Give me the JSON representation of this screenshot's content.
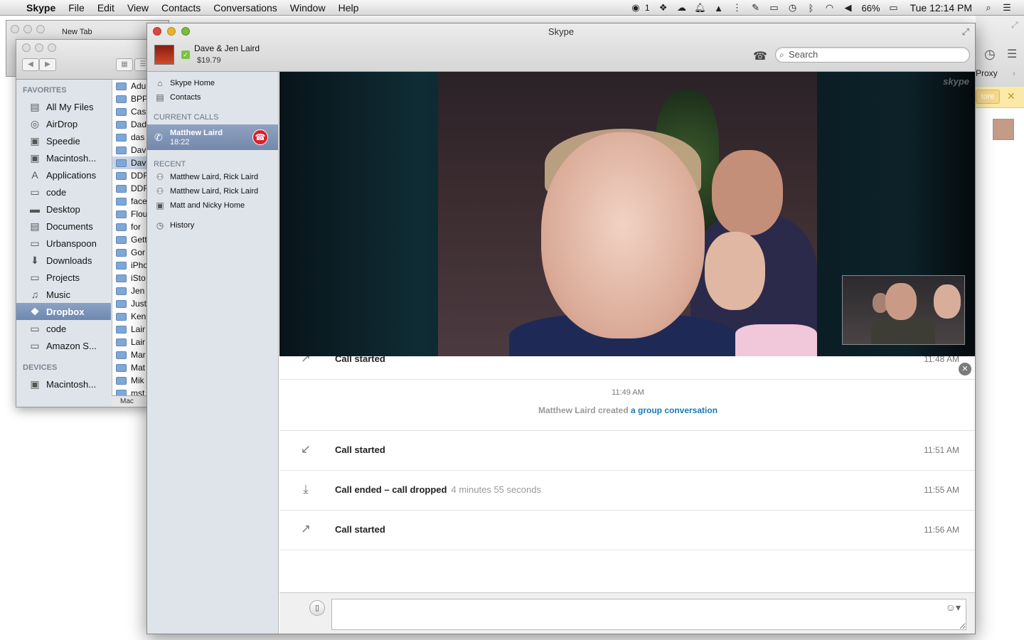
{
  "menubar": {
    "app_name": "Skype",
    "items": [
      "File",
      "Edit",
      "View",
      "Contacts",
      "Conversations",
      "Window",
      "Help"
    ],
    "badge_count": "1",
    "battery": "66%",
    "clock": "Tue 12:14 PM"
  },
  "browser": {
    "tab_label": "New Tab"
  },
  "finder": {
    "favorites_header": "FAVORITES",
    "favorites": [
      {
        "label": "All My Files",
        "icon": "all-files-icon"
      },
      {
        "label": "AirDrop",
        "icon": "airdrop-icon"
      },
      {
        "label": "Speedie",
        "icon": "drive-icon"
      },
      {
        "label": "Macintosh...",
        "icon": "drive-icon"
      },
      {
        "label": "Applications",
        "icon": "applications-icon"
      },
      {
        "label": "code",
        "icon": "folder-icon"
      },
      {
        "label": "Desktop",
        "icon": "desktop-icon"
      },
      {
        "label": "Documents",
        "icon": "documents-icon"
      },
      {
        "label": "Urbanspoon",
        "icon": "folder-icon"
      },
      {
        "label": "Downloads",
        "icon": "downloads-icon"
      },
      {
        "label": "Projects",
        "icon": "folder-icon"
      },
      {
        "label": "Music",
        "icon": "music-icon"
      },
      {
        "label": "Dropbox",
        "icon": "dropbox-icon",
        "selected": true
      },
      {
        "label": "code",
        "icon": "folder-icon"
      },
      {
        "label": "Amazon S...",
        "icon": "folder-icon"
      }
    ],
    "devices_header": "DEVICES",
    "devices": [
      {
        "label": "Macintosh...",
        "icon": "drive-icon"
      }
    ],
    "files": [
      "Adu",
      "BPP",
      "Cas",
      "Dad",
      "das",
      "Dav",
      "Dav",
      "DDF",
      "DDF",
      "face",
      "Flou",
      "for",
      "Gett",
      "Gor",
      "iPho",
      "iSto",
      "Jen",
      "Just",
      "Ken",
      "Lair",
      "Lair",
      "Mar",
      "Mat",
      "Mik",
      "mst"
    ],
    "status": "Mac"
  },
  "right_window": {
    "proxy_label": "Proxy",
    "store_label": "tore"
  },
  "skype": {
    "window_title": "Skype",
    "account_name": "Dave & Jen Laird",
    "credit": "$19.79",
    "search_placeholder": "Search",
    "nav": {
      "home": "Skype Home",
      "contacts": "Contacts",
      "history": "History"
    },
    "current_calls_header": "CURRENT CALLS",
    "current_call": {
      "name": "Matthew Laird",
      "duration": "18:22"
    },
    "recent_header": "RECENT",
    "recent": [
      {
        "label": "Matthew Laird, Rick Laird",
        "icon": "group-icon"
      },
      {
        "label": "Matthew Laird, Rick Laird",
        "icon": "group-icon"
      },
      {
        "label": "Matt and Nicky Home",
        "icon": "contact-card-icon"
      }
    ],
    "video_watermark": "skype",
    "conversation": {
      "top_partial": {
        "text": "Call started",
        "time": "11:48 AM"
      },
      "group_event": {
        "time": "11:49 AM",
        "actor": "Matthew Laird created",
        "link": "a group conversation"
      },
      "events": [
        {
          "text": "Call started",
          "duration": "",
          "time": "11:51 AM",
          "icon": "incoming-call-icon"
        },
        {
          "text": "Call ended – call dropped",
          "duration": "4 minutes 55 seconds",
          "time": "11:55 AM",
          "icon": "call-ended-icon"
        },
        {
          "text": "Call started",
          "duration": "",
          "time": "11:56 AM",
          "icon": "outgoing-call-icon"
        }
      ]
    },
    "message_placeholder": ""
  }
}
